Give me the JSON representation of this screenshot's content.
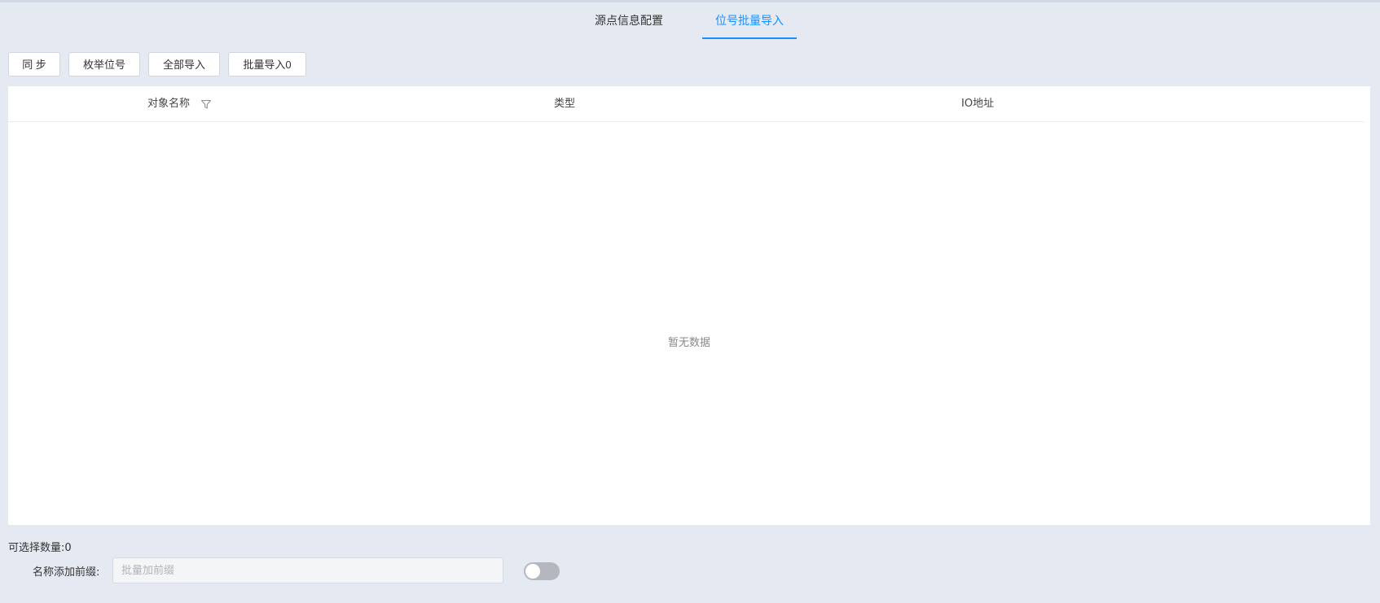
{
  "tabs": [
    {
      "label": "源点信息配置",
      "active": false
    },
    {
      "label": "位号批量导入",
      "active": true
    }
  ],
  "toolbar": {
    "sync_label": "同 步",
    "enumerate_label": "枚举位号",
    "import_all_label": "全部导入",
    "batch_import_label": "批量导入0"
  },
  "table": {
    "columns": [
      "对象名称",
      "类型",
      "IO地址"
    ],
    "rows": [],
    "empty_text": "暂无数据"
  },
  "footer": {
    "selectable_count": "可选择数量:0",
    "prefix_label": "名称添加前缀:",
    "prefix_value": "",
    "prefix_placeholder": "批量加前缀",
    "prefix_toggle_on": false
  },
  "colors": {
    "accent": "#1890ff",
    "page_background": "#e4e9f2",
    "toggle_off": "#b4b7bd"
  },
  "icons": {
    "filter": "filter-funnel-icon"
  }
}
